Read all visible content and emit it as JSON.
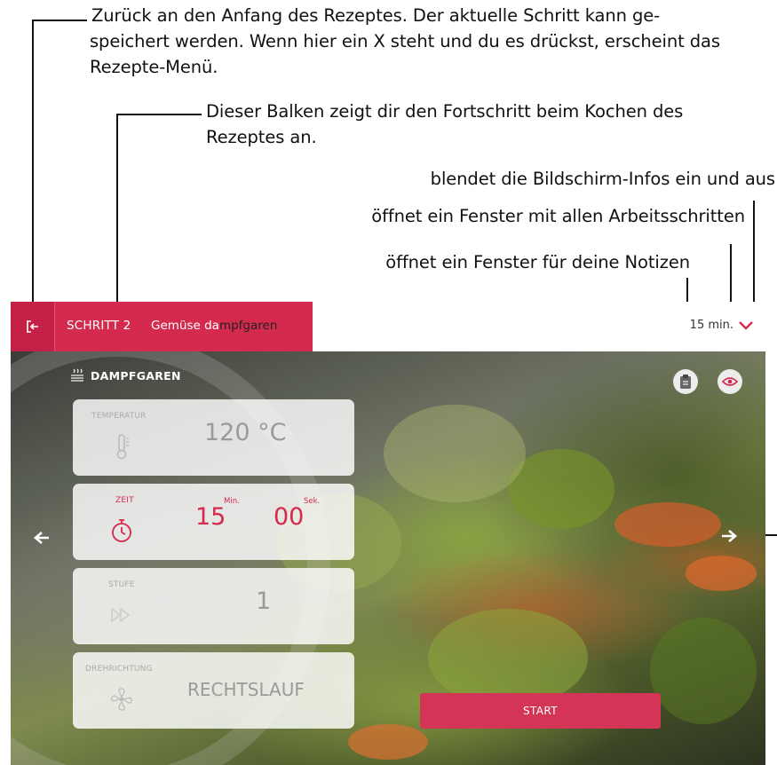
{
  "annotations": {
    "back_line1": "Zurück an den Anfang des Rezeptes. Der aktuelle Schritt kann ge-",
    "back_rest": "speichert werden. Wenn hier ein X steht und du es drückst, erscheint das Rezepte-Menü.",
    "progress_bar": "Dieser Balken zeigt dir den Fortschritt beim Kochen des Rezeptes an.",
    "eye": "blendet die Bildschirm-Infos ein und aus",
    "steps": "öffnet ein Fenster mit allen Arbeitsschritten",
    "notes": "öffnet ein Fenster für deine Notizen"
  },
  "header": {
    "step_number": "SCHRITT 2",
    "step_title_highlighted": "Gemüse da",
    "step_title_rest": "mpfgaren",
    "duration": "15 min.",
    "progress_fraction": 0.4,
    "back_icon": "exit-icon",
    "accent_color": "#d42a4e"
  },
  "mode": {
    "label": "DAMPFGAREN",
    "icon": "steam-icon"
  },
  "settings": {
    "temperature": {
      "label": "TEMPERATUR",
      "value": "120 °C",
      "icon": "thermometer-icon"
    },
    "time": {
      "label": "ZEIT",
      "minutes": "15",
      "minutes_unit": "Min.",
      "seconds": "00",
      "seconds_unit": "Sek.",
      "icon": "timer-icon",
      "color": "#d42a4e"
    },
    "level": {
      "label": "STUFE",
      "value": "1",
      "icon": "fast-forward-icon"
    },
    "direction": {
      "label": "DREHRICHTUNG",
      "value": "RECHTSLAUF",
      "icon": "fan-icon"
    }
  },
  "actions": {
    "start_label": "START",
    "notes_icon": "notes-icon",
    "eye_icon": "eye-icon",
    "prev_icon": "arrow-left-icon",
    "next_icon": "arrow-right-icon",
    "expand_icon": "chevron-down-icon"
  }
}
